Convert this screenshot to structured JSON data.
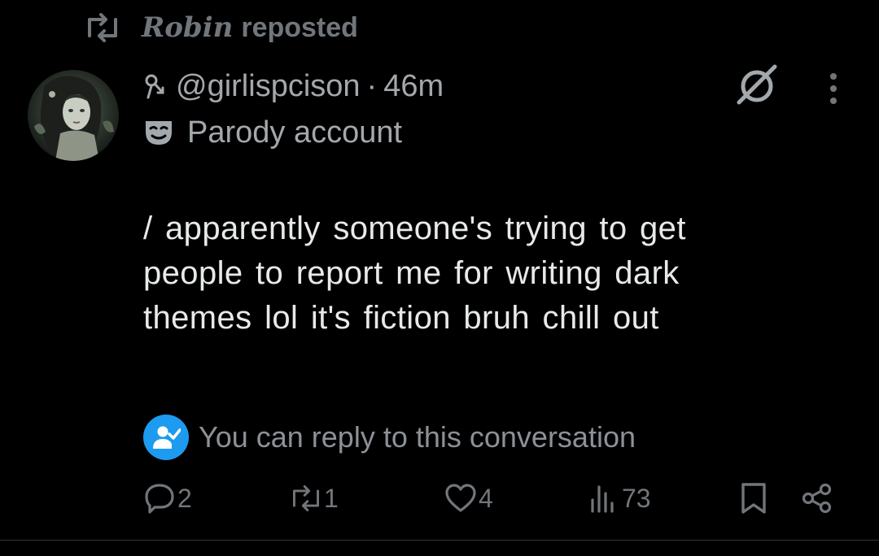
{
  "repost": {
    "name": "Robin",
    "label": "reposted"
  },
  "post": {
    "handle": "@girlispcison",
    "separator": "·",
    "time": "46m",
    "badge_text": "Parody account",
    "text": "/ apparently someone's trying to get people to report me for writing dark themes lol it's fiction bruh chill out"
  },
  "reply_notice": {
    "text": "You can reply to this conversation"
  },
  "actions": {
    "replies": "2",
    "reposts": "1",
    "likes": "4",
    "views": "73"
  },
  "icons": {
    "repost_header": "repost-icon",
    "pin": "pin-icon",
    "parody": "theater-mask-icon",
    "grok": "grok-icon",
    "more": "more-vertical-icon",
    "reply_badge": "person-check-icon",
    "reply": "reply-icon",
    "repost": "repost-icon",
    "like": "heart-icon",
    "views": "views-icon",
    "bookmark": "bookmark-icon",
    "share": "share-icon"
  },
  "colors": {
    "background": "#000000",
    "text_primary": "#e7e9ea",
    "text_secondary": "#71767b",
    "accent": "#1d9bf0"
  }
}
